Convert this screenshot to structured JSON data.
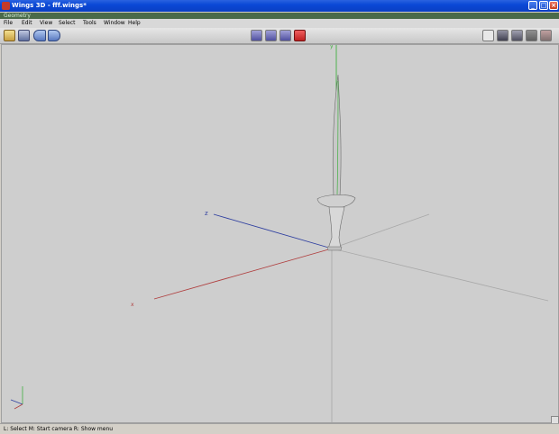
{
  "window": {
    "title": "Wings 3D - fff.wings*"
  },
  "geometry_bar": {
    "label": "Geometry"
  },
  "menu": {
    "items": [
      "File",
      "Edit",
      "View",
      "Select",
      "Tools",
      "Window",
      "Help"
    ]
  },
  "toolbar": {
    "left_icons": [
      "open-icon",
      "save-icon",
      "undo-icon",
      "redo-icon"
    ],
    "selection_modes": [
      "vertex-mode-icon",
      "edge-mode-icon",
      "face-mode-icon",
      "body-mode-icon"
    ],
    "active_selection_mode": "body-mode-icon",
    "right_icons": [
      "wireframe-icon",
      "smooth-shade-icon",
      "flat-shade-icon",
      "ground-icon",
      "axes-icon"
    ]
  },
  "viewport": {
    "axis_labels": {
      "x": "x",
      "y": "y",
      "z": "z"
    },
    "colors": {
      "x_axis": "#b04040",
      "y_axis": "#40b040",
      "z_axis": "#3040a0",
      "grid": "#a8a8a8",
      "model": "#b8b8b8"
    }
  },
  "status": {
    "text": "L: Select   M: Start camera   R: Show menu"
  }
}
